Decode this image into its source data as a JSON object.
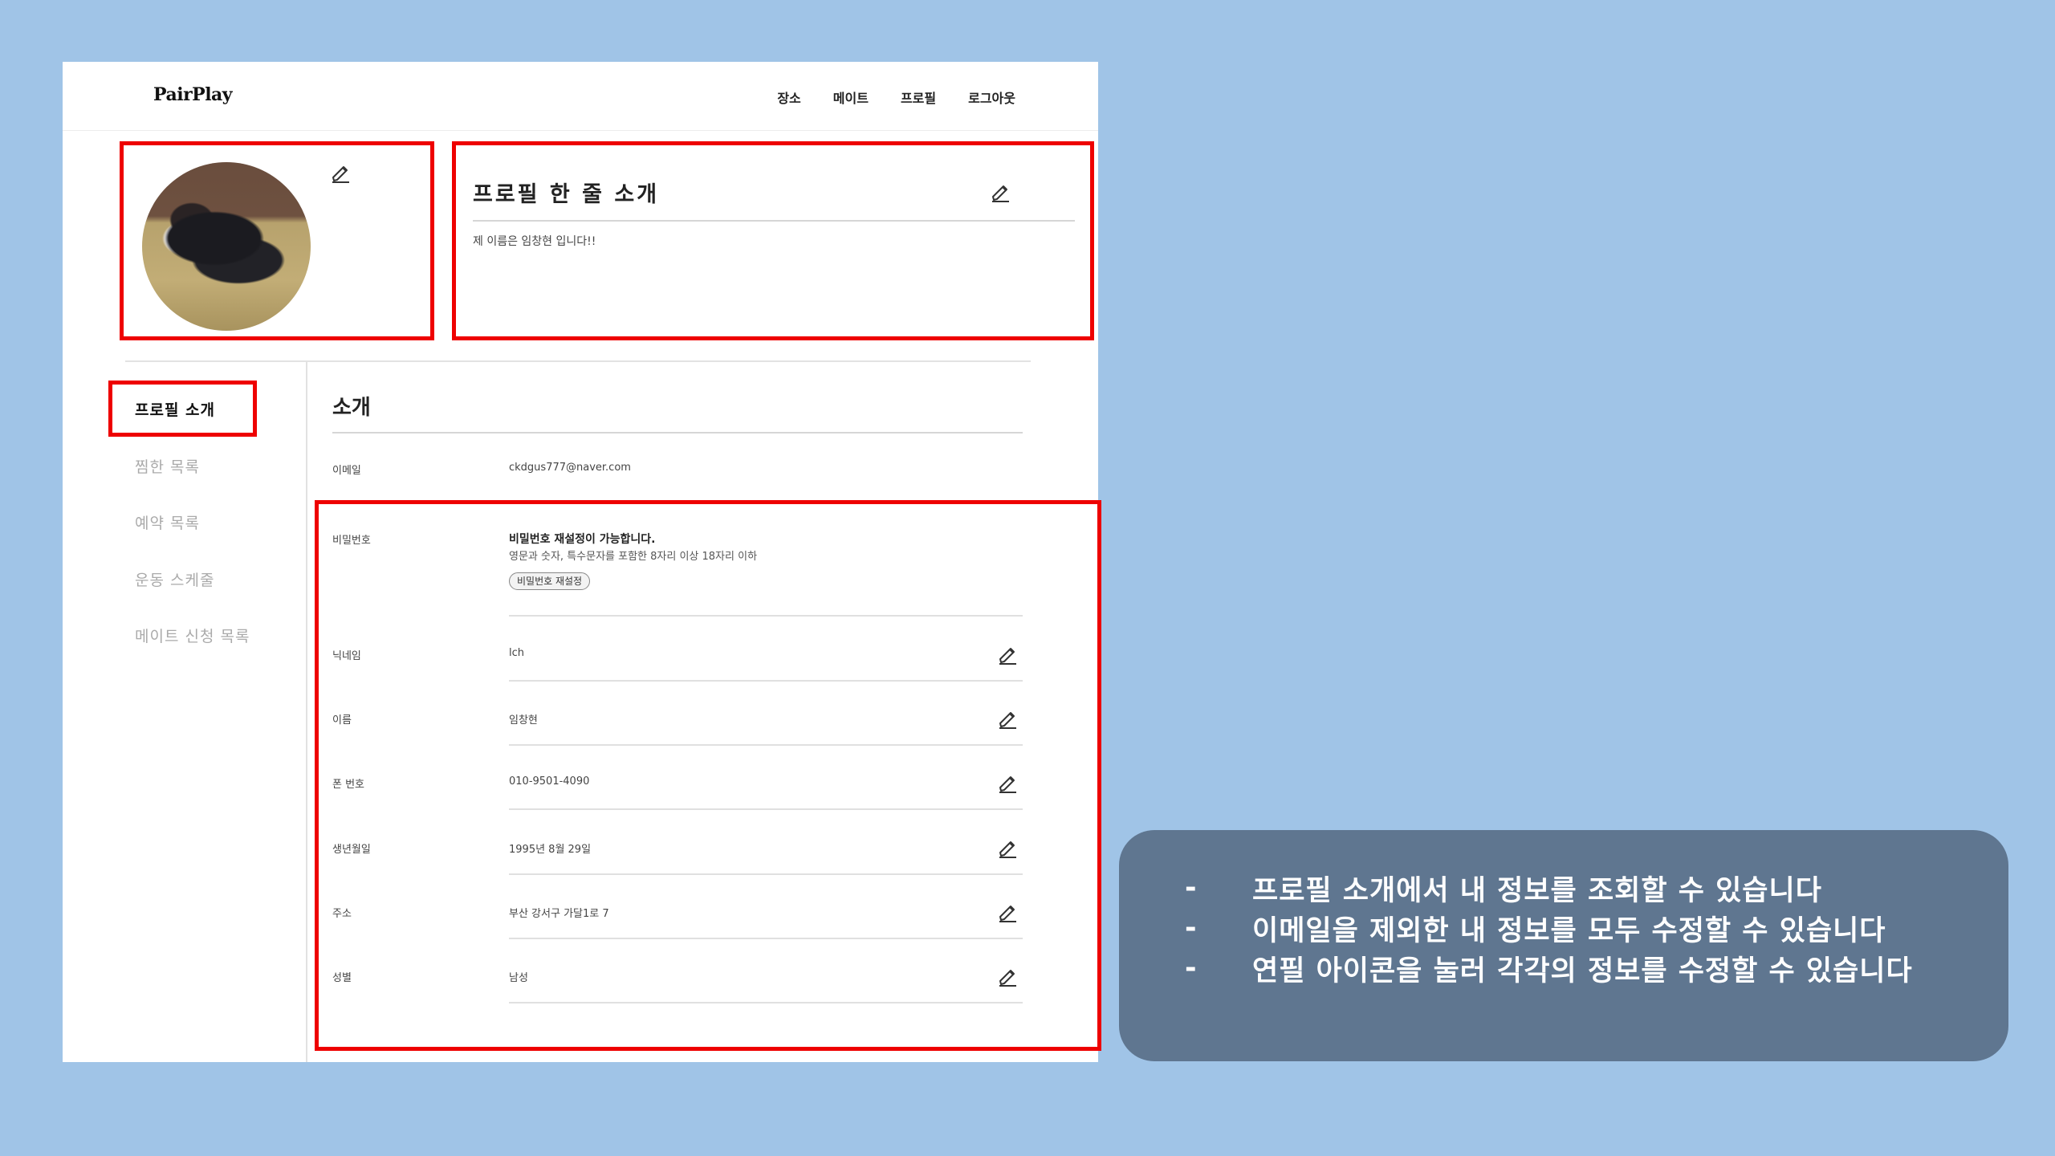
{
  "app": {
    "logo": "PairPlay",
    "nav": [
      "장소",
      "메이트",
      "프로필",
      "로그아웃"
    ]
  },
  "profile": {
    "intro_title": "프로필 한 줄 소개",
    "intro_text": "제 이름은 임창현 입니다!!"
  },
  "sidebar": {
    "items": [
      "프로필 소개",
      "찜한 목록",
      "예약 목록",
      "운동 스케줄",
      "메이트 신청 목록"
    ],
    "active_index": 0
  },
  "section": {
    "title": "소개",
    "email_label": "이메일",
    "email_value": "ckdgus777@naver.com",
    "password": {
      "label": "비밀번호",
      "heading": "비밀번호 재설정이 가능합니다.",
      "help": "영문과 숫자, 특수문자를 포함한 8자리 이상 18자리 이하",
      "button": "비밀번호 재설정"
    },
    "fields": [
      {
        "label": "닉네임",
        "value": "lch"
      },
      {
        "label": "이름",
        "value": "임창현"
      },
      {
        "label": "폰 번호",
        "value": "010-9501-4090"
      },
      {
        "label": "생년월일",
        "value": "1995년 8월 29일"
      },
      {
        "label": "주소",
        "value": "부산 강서구 가달1로 7"
      },
      {
        "label": "성별",
        "value": "남성"
      }
    ]
  },
  "annotation": {
    "bullets": [
      "프로필 소개에서 내 정보를 조회할 수 있습니다",
      "이메일을 제외한 내 정보를 모두 수정할 수 있습니다",
      "연필 아이콘을 눌러 각각의 정보를 수정할 수 있습니다"
    ],
    "bullet_marker": "-"
  },
  "colors": {
    "background": "#a0c4e7",
    "highlight_border": "#ee0000",
    "annotation_box": "#5f7690"
  },
  "icons": {
    "edit": "pencil-icon"
  }
}
